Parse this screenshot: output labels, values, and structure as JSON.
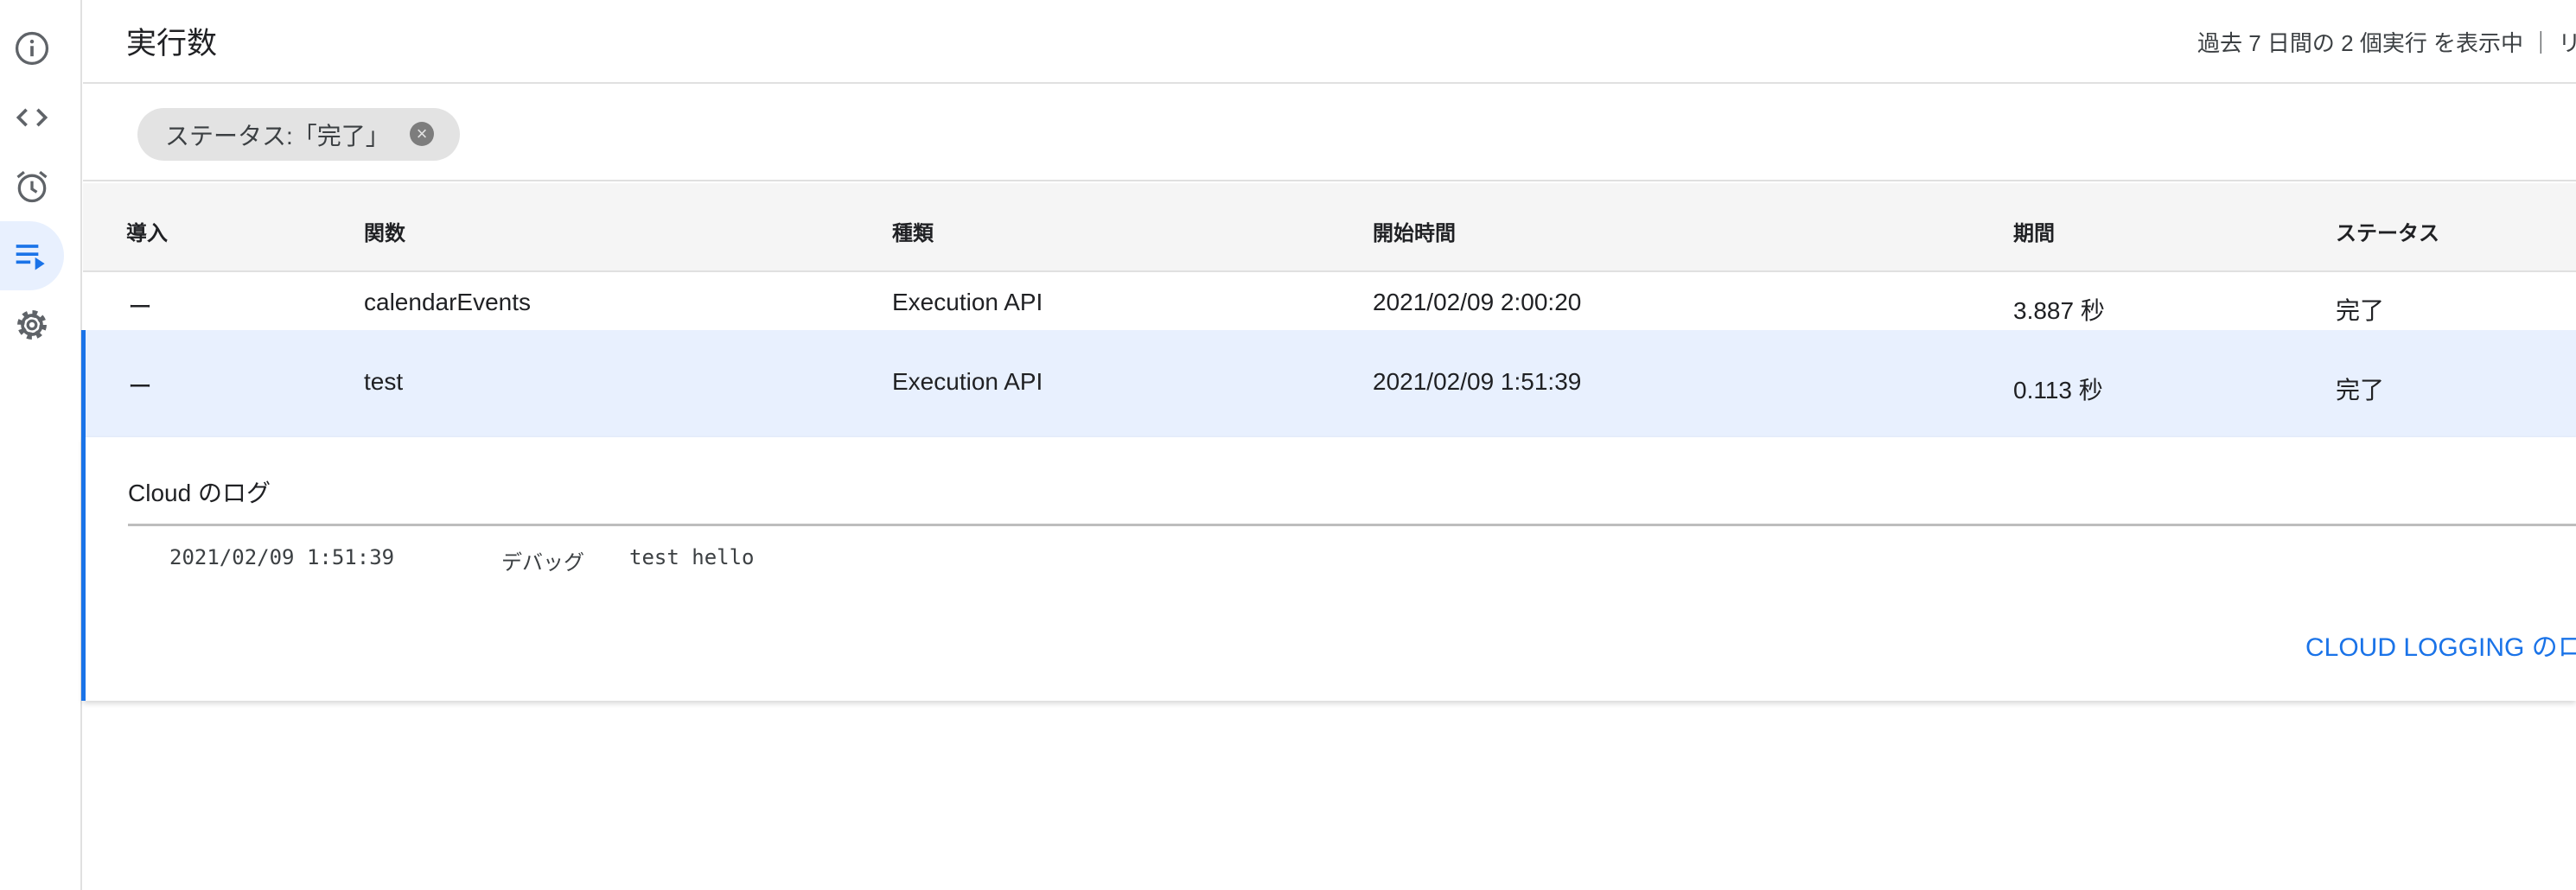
{
  "sidebar": {
    "items": [
      {
        "icon": "info-icon",
        "active": false
      },
      {
        "icon": "code-icon",
        "active": false
      },
      {
        "icon": "alarm-clock-icon",
        "active": false
      },
      {
        "icon": "executions-icon",
        "active": true
      },
      {
        "icon": "gear-icon",
        "active": false
      }
    ]
  },
  "header": {
    "title": "実行数",
    "summary": "過去 7 日間の 2 個実行 を表示中 ｜ リ"
  },
  "filter": {
    "chip_label": "ステータス:「完了」"
  },
  "table": {
    "headers": [
      "導入",
      "関数",
      "種類",
      "開始時間",
      "期間",
      "ステータス"
    ],
    "rows": [
      [
        "ー",
        "calendarEvents",
        "Execution API",
        "2021/02/09 2:00:20",
        "3.887 秒",
        "完了"
      ],
      [
        "ー",
        "test",
        "Execution API",
        "2021/02/09 1:51:39",
        "0.113 秒",
        "完了"
      ]
    ],
    "selected_row": 1
  },
  "log_panel": {
    "title": "Cloud のログ",
    "entries": [
      {
        "time": "2021/02/09 1:51:39",
        "level": "デバッグ",
        "message": "test hello"
      }
    ],
    "link": "CLOUD LOGGING のロ"
  },
  "colors": {
    "accent": "#1a73e8",
    "selected_row_bg": "#e8f0fe",
    "header_bg": "#f5f5f5",
    "chip_bg": "#e3e3e3"
  }
}
